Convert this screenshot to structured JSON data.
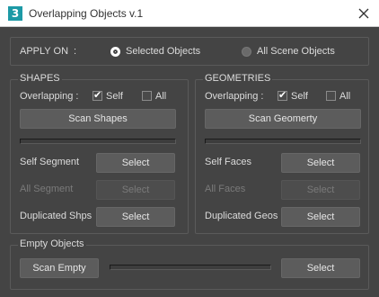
{
  "window": {
    "title": "Overlapping Objects v.1",
    "app_icon_glyph": "3",
    "close_icon": "close-icon"
  },
  "apply_on": {
    "label": "APPLY ON",
    "separator": ":",
    "options": [
      {
        "label": "Selected Objects",
        "selected": true
      },
      {
        "label": "All Scene Objects",
        "selected": false
      }
    ]
  },
  "shapes": {
    "title": "SHAPES",
    "overlapping_label": "Overlapping :",
    "self_label": "Self",
    "self_checked": true,
    "all_label": "All",
    "all_checked": false,
    "scan_button": "Scan Shapes",
    "progress": 0,
    "rows": [
      {
        "label": "Self Segment",
        "button": "Select",
        "enabled": true
      },
      {
        "label": "All Segment",
        "button": "Select",
        "enabled": false
      },
      {
        "label": "Duplicated Shps",
        "button": "Select",
        "enabled": true
      }
    ]
  },
  "geometries": {
    "title": "GEOMETRIES",
    "overlapping_label": "Overlapping :",
    "self_label": "Self",
    "self_checked": true,
    "all_label": "All",
    "all_checked": false,
    "scan_button": "Scan Geomerty",
    "progress": 0,
    "rows": [
      {
        "label": "Self Faces",
        "button": "Select",
        "enabled": true
      },
      {
        "label": "All Faces",
        "button": "Select",
        "enabled": false
      },
      {
        "label": "Duplicated Geos",
        "button": "Select",
        "enabled": true
      }
    ]
  },
  "empty_objects": {
    "title": "Empty Objects",
    "scan_button": "Scan Empty",
    "progress": 0,
    "select_button": "Select"
  },
  "colors": {
    "background": "#444444",
    "accent": "#1d9aa6"
  }
}
